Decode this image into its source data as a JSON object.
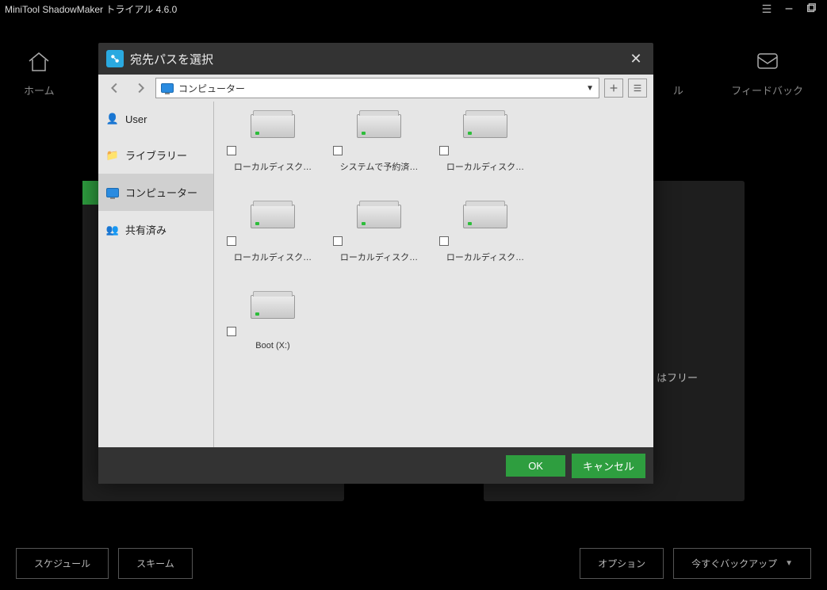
{
  "app": {
    "title": "MiniTool ShadowMaker トライアル 4.6.0"
  },
  "bg": {
    "tabs": {
      "home": "ホーム",
      "feedback": "フィードバック",
      "tool_suffix": "ル"
    },
    "bottom": {
      "schedule": "スケジュール",
      "scheme": "スキーム",
      "options": "オプション",
      "backup_now": "今すぐバックアップ"
    },
    "peek": "はフリー"
  },
  "modal": {
    "title": "宛先パスを選択",
    "path_label": "コンピューター",
    "sidebar": [
      {
        "key": "user",
        "label": "User"
      },
      {
        "key": "library",
        "label": "ライブラリー"
      },
      {
        "key": "computer",
        "label": "コンピューター"
      },
      {
        "key": "shared",
        "label": "共有済み"
      }
    ],
    "drives": [
      {
        "label": "ローカルディスク…"
      },
      {
        "label": "システムで予約済…"
      },
      {
        "label": "ローカルディスク…"
      },
      {
        "label": "ローカルディスク…"
      },
      {
        "label": "ローカルディスク…"
      },
      {
        "label": "ローカルディスク…"
      },
      {
        "label": "Boot (X:)"
      }
    ],
    "ok": "OK",
    "cancel": "キャンセル"
  }
}
